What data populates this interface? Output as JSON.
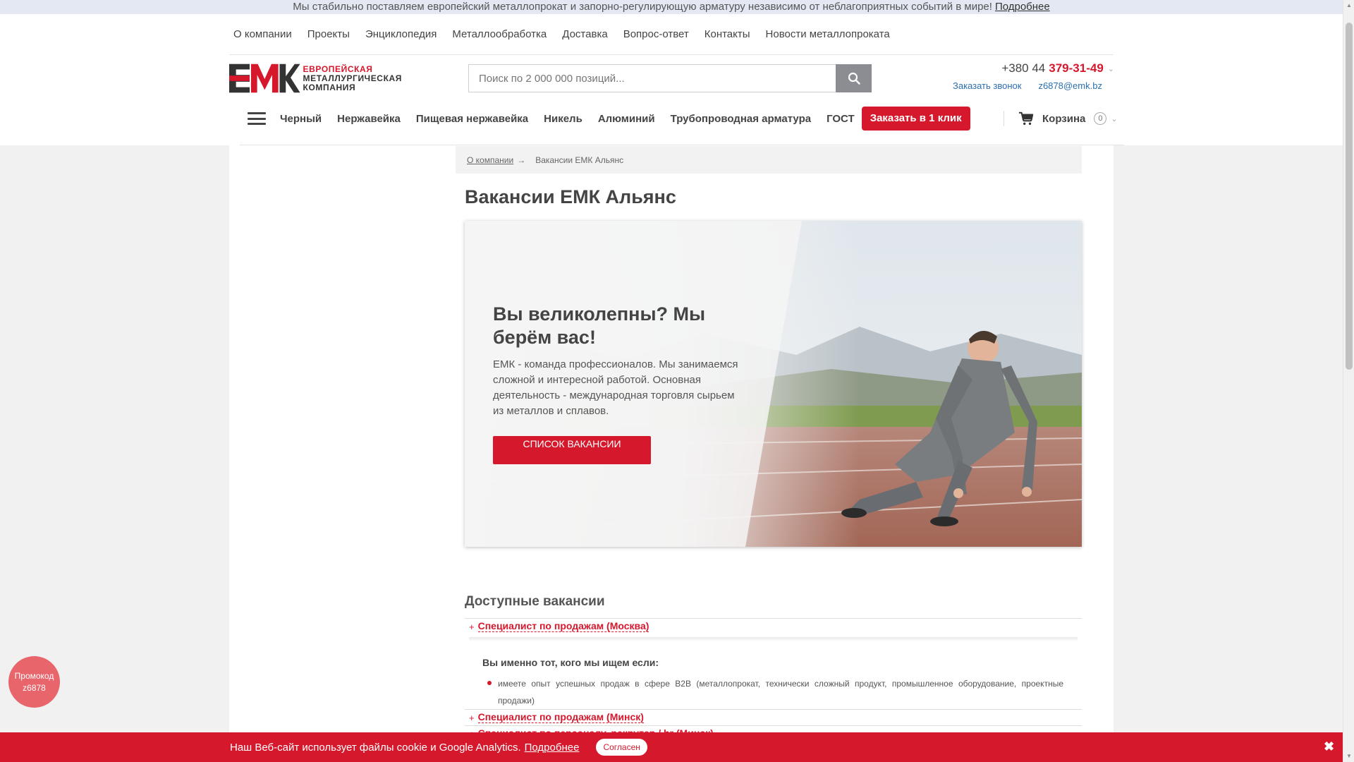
{
  "notice": {
    "text": "Мы стабильно поставляем европейский металлопрокат и запорно-регулирующую арматуру независимо от неблагоприятных событий в мире!",
    "link": "Подробнее"
  },
  "top_nav": [
    "О компании",
    "Проекты",
    "Энциклопедия",
    "Металлообработка",
    "Доставка",
    "Вопрос-ответ",
    "Контакты",
    "Новости металлопроката"
  ],
  "logo": {
    "line1": "ЕВРОПЕЙСКАЯ",
    "line2": "МЕТАЛЛУРГИЧЕСКАЯ",
    "line3": "КОМПАНИЯ"
  },
  "search": {
    "placeholder": "Поиск по 2 000 000 позиций..."
  },
  "phone": {
    "prefix": "+380 44",
    "number": "379-31-49"
  },
  "contacts": {
    "callback": "Заказать звонок",
    "email": "z6878@emk.bz"
  },
  "category_nav": [
    "Черный",
    "Нержавейка",
    "Пищевая нержавейка",
    "Никель",
    "Алюминий",
    "Трубопроводная арматура",
    "ГОСТ"
  ],
  "order_button": "Заказать в 1 клик",
  "cart": {
    "label": "Корзина",
    "count": "0"
  },
  "breadcrumb": {
    "parent": "О компании",
    "arrow": "→",
    "current": "Вакансии ЕМК Альянс"
  },
  "page_title": "Вакансии ЕМК Альянс",
  "hero": {
    "heading": "Вы великолепны? Мы берём вас!",
    "text": "ЕМК - команда профессионалов. Мы занимаемся сложной и интересной работой. Основная деятельность - международная торговля сырьем из металлов и сплавов.",
    "button": "СПИСОК ВАКАНСИИ"
  },
  "vacancies": {
    "title": "Доступные вакансии",
    "items": [
      "Специалист по продажам (Москва)",
      "Специалист по продажам (Минск)",
      "Специалист по персоналу, рекрутер / hr (Минск)"
    ],
    "expanded": {
      "heading": "Вы именно тот, кого мы ищем если:",
      "bullets": [
        "имеете опыт успешных продаж в сфере B2B (металлопрокат, технически сложный продукт, промышленное оборудование, проектные продажи)"
      ]
    }
  },
  "promo": {
    "line1": "Промокод",
    "line2": "z6878"
  },
  "cookie": {
    "text": "Наш Веб-сайт использует файлы cookie и Google Analytics.",
    "link": "Подробнее",
    "accept": "Согласен",
    "close": "✖"
  },
  "colors": {
    "brand_red": "#d6182c",
    "link_blue": "#2b6fb0",
    "notice_bg": "#e3e8f3"
  }
}
